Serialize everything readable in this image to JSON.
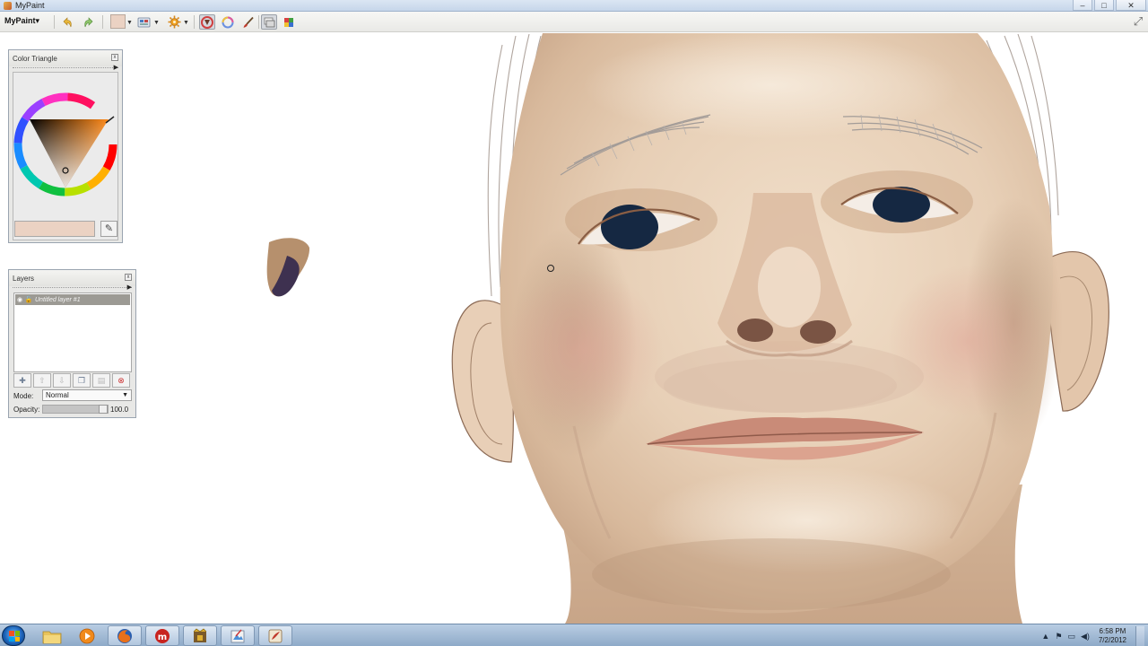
{
  "window": {
    "title": "MyPaint",
    "controls": {
      "minimize": "–",
      "maximize": "□",
      "close": "✕"
    }
  },
  "toolbar": {
    "app_menu": "MyPaint▾",
    "icons": [
      "undo-icon",
      "redo-icon",
      "color-swatch",
      "brush-presets-icon",
      "settings-icon",
      "color-triangle-icon",
      "color-ring-icon",
      "brush-icon",
      "layers-icon",
      "palette-icon"
    ],
    "current_color": "#ebd2c3"
  },
  "color_panel": {
    "title": "Color Triangle",
    "close": "x",
    "value_color": "#ebd2c3",
    "eyedropper": "✎"
  },
  "layers_panel": {
    "title": "Layers",
    "close": "x",
    "layers": [
      {
        "name": "Untitled layer #1",
        "visible_icon": "◉",
        "lock_icon": "🔓"
      }
    ],
    "buttons": [
      {
        "name": "add-layer-button",
        "glyph": "✚",
        "enabled": true
      },
      {
        "name": "move-layer-up-button",
        "glyph": "⇧",
        "enabled": false
      },
      {
        "name": "move-layer-down-button",
        "glyph": "⇩",
        "enabled": false
      },
      {
        "name": "duplicate-layer-button",
        "glyph": "❐",
        "enabled": true
      },
      {
        "name": "merge-layer-button",
        "glyph": "▤",
        "enabled": false
      },
      {
        "name": "delete-layer-button",
        "glyph": "⊗",
        "enabled": true
      }
    ],
    "mode_label": "Mode:",
    "mode_value": "Normal",
    "opacity_label": "Opacity:",
    "opacity_value": "100.0",
    "opacity_level": 1.0
  },
  "taskbar": {
    "apps": [
      "explorer-icon",
      "media-player-icon",
      "firefox-icon",
      "miro-icon",
      "game-icon",
      "paint-icon",
      "mypaint-icon"
    ],
    "clock_time": "6:58 PM",
    "clock_date": "7/2/2012",
    "tray": [
      "▲",
      "⚑",
      "▭",
      "◀)"
    ]
  }
}
